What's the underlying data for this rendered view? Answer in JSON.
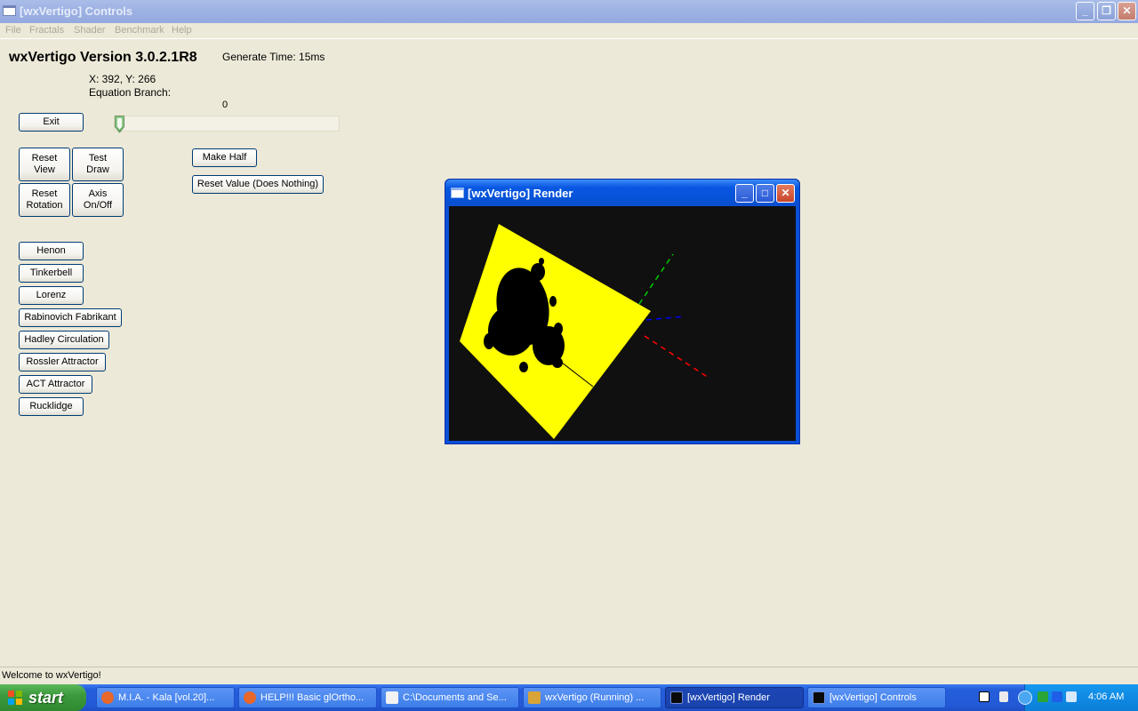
{
  "main_window": {
    "title": "[wxVertigo] Controls"
  },
  "menu": {
    "items": [
      "File",
      "Fractals",
      "Shader",
      "Benchmark",
      "Help"
    ]
  },
  "header": {
    "version": "wxVertigo Version 3.0.2.1R8",
    "generate_time": "Generate Time: 15ms",
    "coords": "X: 392, Y: 266",
    "equation_branch": "Equation Branch:",
    "slider_value": "0"
  },
  "slider": {
    "value": 0
  },
  "buttons": {
    "exit": "Exit",
    "reset_view": "Reset\nView",
    "test_draw": "Test\nDraw",
    "reset_rotation": "Reset\nRotation",
    "axis_toggle": "Axis\nOn/Off",
    "make_half": "Make Half",
    "reset_value": "Reset Value (Does Nothing)"
  },
  "fractals": [
    "Henon",
    "Tinkerbell",
    "Lorenz",
    "Rabinovich Fabrikant",
    "Hadley Circulation",
    "Rossler Attractor",
    "ACT Attractor",
    "Rucklidge"
  ],
  "render_window": {
    "title": "[wxVertigo] Render"
  },
  "status": {
    "text": "Welcome to wxVertigo!"
  },
  "taskbar": {
    "start": "start",
    "tasks": [
      "M.I.A. - Kala [vol.20]...",
      "HELP!!! Basic glOrtho...",
      "C:\\Documents and Se...",
      "wxVertigo (Running) ...",
      "[wxVertigo] Render",
      "[wxVertigo] Controls"
    ],
    "clock": "4:06 AM"
  },
  "colors": {
    "fractal_fill": "#ffff00",
    "axis_x": "#ff0000",
    "axis_y": "#00cc00",
    "axis_z": "#0000ff"
  }
}
